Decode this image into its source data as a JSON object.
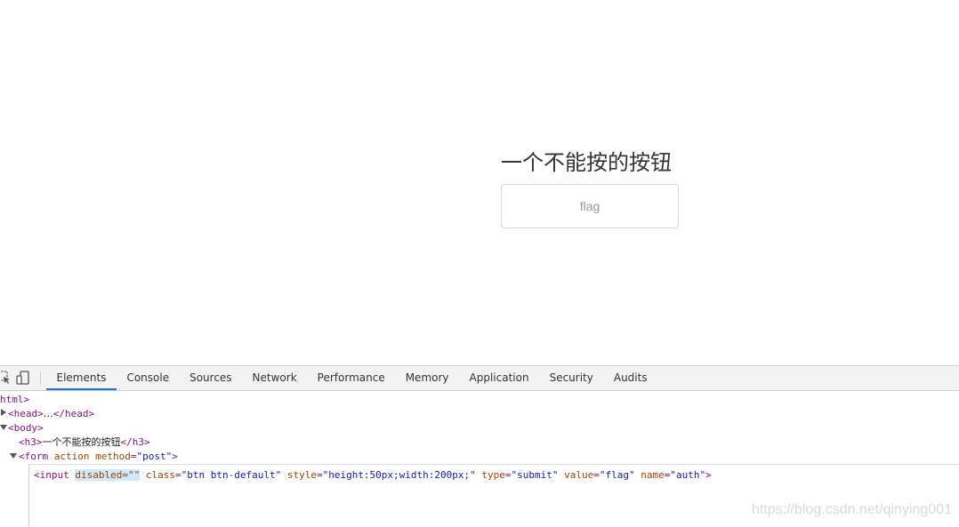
{
  "page": {
    "heading": "一个不能按的按钮",
    "button_value": "flag"
  },
  "devtools": {
    "tabs": [
      "Elements",
      "Console",
      "Sources",
      "Network",
      "Performance",
      "Memory",
      "Application",
      "Security",
      "Audits"
    ],
    "active_tab": "Elements",
    "dom": {
      "html_open": "html>",
      "head_open": "<head>",
      "head_ellipsis": "…",
      "head_close": "</head>",
      "body_open": "<body>",
      "h3_open": "<h3>",
      "h3_text": "一个不能按的按钮",
      "h3_close": "</h3>",
      "form_tag": "<form",
      "form_attr1": "action",
      "form_attr2_name": "method",
      "form_attr2_eq": "=",
      "form_attr2_val": "\"post\"",
      "form_close": ">",
      "input_open": "<input",
      "input_disabled": "disabled=\"\"",
      "input_class_name": "class",
      "input_class_val": "\"btn btn-default\"",
      "input_style_name": "style",
      "input_style_val": "\"height:50px;width:200px;\"",
      "input_type_name": "type",
      "input_type_val": "\"submit\"",
      "input_value_name": "value",
      "input_value_val": "\"flag\"",
      "input_name_name": "name",
      "input_name_val": "\"auth\"",
      "input_close": ">"
    }
  },
  "watermark": "https://blog.csdn.net/qinying001",
  "colors": {
    "tag": "#881280",
    "attr_name": "#994500",
    "attr_value": "#1a1aa6",
    "active_tab_underline": "#1a73e8",
    "selection_highlight": "#cfe8fc"
  },
  "icons": [
    "inspect-element-icon",
    "device-toolbar-icon"
  ]
}
